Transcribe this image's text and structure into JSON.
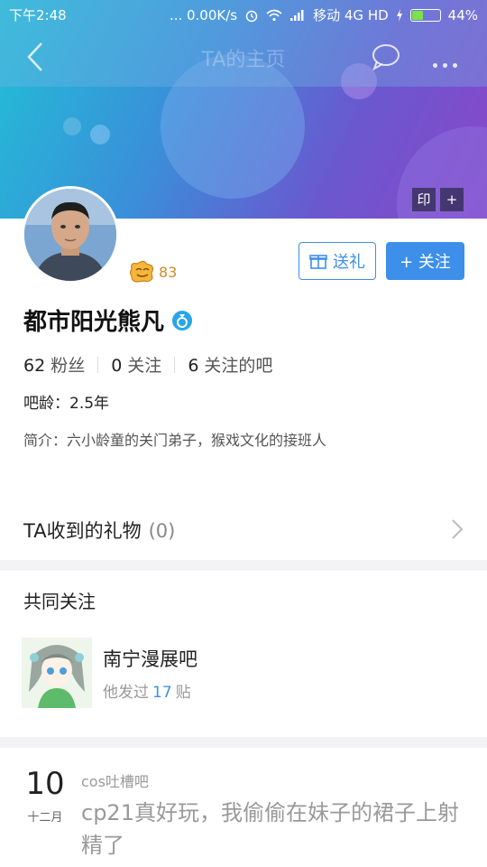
{
  "status_bar": {
    "time": "下午2:48",
    "network_speed": "... 0.00K/s",
    "carrier": "移动 4G HD",
    "battery_percent": "44%",
    "battery_level": 0.44
  },
  "nav": {
    "title": "TA的主页"
  },
  "banner": {
    "stamp_label": "印",
    "add_label": "+"
  },
  "profile": {
    "level": "83",
    "gift_button_label": "送礼",
    "follow_button_label": "+ 关注",
    "username": "都市阳光熊凡",
    "stats": [
      {
        "num": "62",
        "label": "粉丝"
      },
      {
        "num": "0",
        "label": "关注"
      },
      {
        "num": "6",
        "label": "关注的吧"
      }
    ],
    "age": "吧龄：2.5年",
    "bio": "简介：六小龄童的关门弟子，猴戏文化的接班人"
  },
  "gifts": {
    "label": "TA收到的礼物",
    "count": "(0)"
  },
  "common": {
    "title": "共同关注",
    "bar_name": "南宁漫展吧",
    "meta_prefix": "他发过",
    "meta_count": "17",
    "meta_suffix": "贴"
  },
  "post": {
    "day": "10",
    "month": "十二月",
    "forum": "cos吐槽吧",
    "text": "cp21真好玩，我偷偷在妹子的裙子上射精了"
  },
  "colors": {
    "accent": "#3d8fea",
    "level": "#d08a2a"
  }
}
